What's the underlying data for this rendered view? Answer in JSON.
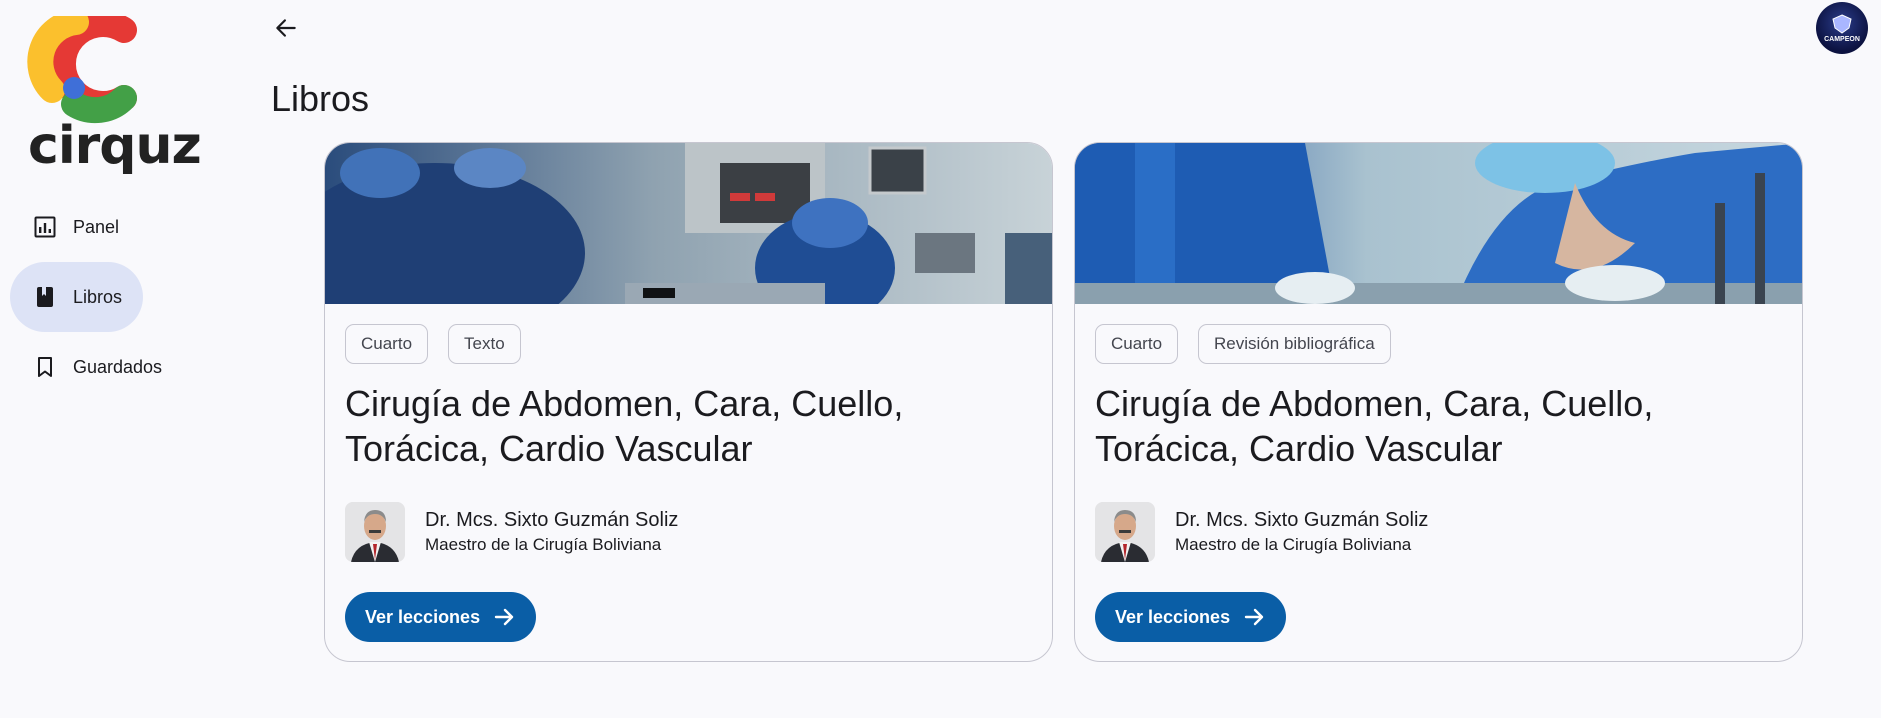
{
  "brand": {
    "name": "cirquz"
  },
  "sidebar": {
    "items": [
      {
        "label": "Panel",
        "icon": "chart-icon",
        "active": false
      },
      {
        "label": "Libros",
        "icon": "book-icon",
        "active": true
      },
      {
        "label": "Guardados",
        "icon": "bookmark-icon",
        "active": false
      }
    ]
  },
  "header": {
    "title": "Libros",
    "avatar_text": "CAMPEON"
  },
  "books": [
    {
      "tags": [
        "Cuarto",
        "Texto"
      ],
      "title": "Cirugía de Abdomen, Cara, Cuello, Torácica, Cardio Vascular",
      "author_name": "Dr. Mcs. Sixto Guzmán Soliz",
      "author_role": "Maestro de la Cirugía Boliviana",
      "cta": "Ver lecciones"
    },
    {
      "tags": [
        "Cuarto",
        "Revisión bibliográfica"
      ],
      "title": "Cirugía de Abdomen, Cara, Cuello, Torácica, Cardio Vascular",
      "author_name": "Dr. Mcs. Sixto Guzmán Soliz",
      "author_role": "Maestro de la Cirugía Boliviana",
      "cta": "Ver lecciones"
    }
  ],
  "colors": {
    "primary": "#0a5ea6",
    "active_nav": "#dde3f6",
    "background": "#f9f9fc"
  }
}
